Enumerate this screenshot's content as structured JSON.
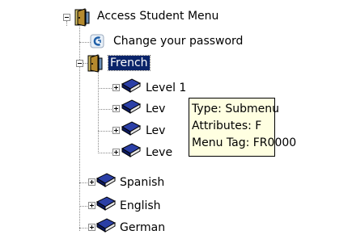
{
  "tree": {
    "root": {
      "label": "Access Student Menu"
    },
    "change_password": {
      "label": "Change your password"
    },
    "french": {
      "label": "French",
      "levels": [
        {
          "label": "Level 1"
        },
        {
          "label": "Lev"
        },
        {
          "label": "Lev"
        },
        {
          "label": "Leve"
        }
      ]
    },
    "spanish": {
      "label": "Spanish"
    },
    "english": {
      "label": "English"
    },
    "german": {
      "label": "German"
    }
  },
  "tooltip": {
    "type_line": "Type: Submenu",
    "attributes_line": "Attributes:  F",
    "menu_tag_line": "Menu Tag: FR0000"
  },
  "colors": {
    "selection_bg": "#0a246a",
    "tooltip_bg": "#ffffe1",
    "book_blue": "#1e2f8a"
  }
}
